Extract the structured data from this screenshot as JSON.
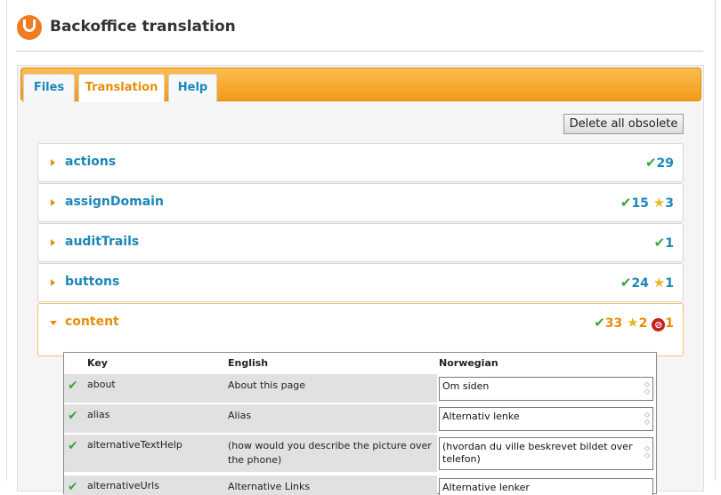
{
  "header": {
    "title": "Backoffice translation"
  },
  "tabs": [
    {
      "label": "Files"
    },
    {
      "label": "Translation"
    },
    {
      "label": "Help"
    }
  ],
  "actions": {
    "delete_obsolete": "Delete all obsolete"
  },
  "sections": [
    {
      "name": "actions",
      "translated": "29",
      "new": "",
      "obsolete": ""
    },
    {
      "name": "assignDomain",
      "translated": "15",
      "new": "3",
      "obsolete": ""
    },
    {
      "name": "auditTrails",
      "translated": "1",
      "new": "",
      "obsolete": ""
    },
    {
      "name": "buttons",
      "translated": "24",
      "new": "1",
      "obsolete": ""
    },
    {
      "name": "content",
      "translated": "33",
      "new": "2",
      "obsolete": "1"
    }
  ],
  "table": {
    "headers": {
      "key": "Key",
      "english": "English",
      "norwegian": "Norwegian"
    },
    "rows": [
      {
        "key": "about",
        "english": "About this page",
        "norwegian": "Om siden"
      },
      {
        "key": "alias",
        "english": "Alias",
        "norwegian": "Alternativ lenke"
      },
      {
        "key": "alternativeTextHelp",
        "english": "(how would you describe the picture over the phone)",
        "norwegian": "(hvordan du ville beskrevet bildet over telefon)"
      },
      {
        "key": "alternativeUrls",
        "english": "Alternative Links",
        "norwegian": "Alternative lenker"
      }
    ]
  },
  "colors": {
    "accent": "#f19a1a",
    "link": "#1b87b8",
    "active": "#e58e0a",
    "ok": "#3aa53a",
    "warn": "#e8b820",
    "error": "#c81e1e"
  },
  "icons": {
    "translated": "check-icon",
    "new": "star-icon",
    "obsolete": "stop-icon"
  }
}
